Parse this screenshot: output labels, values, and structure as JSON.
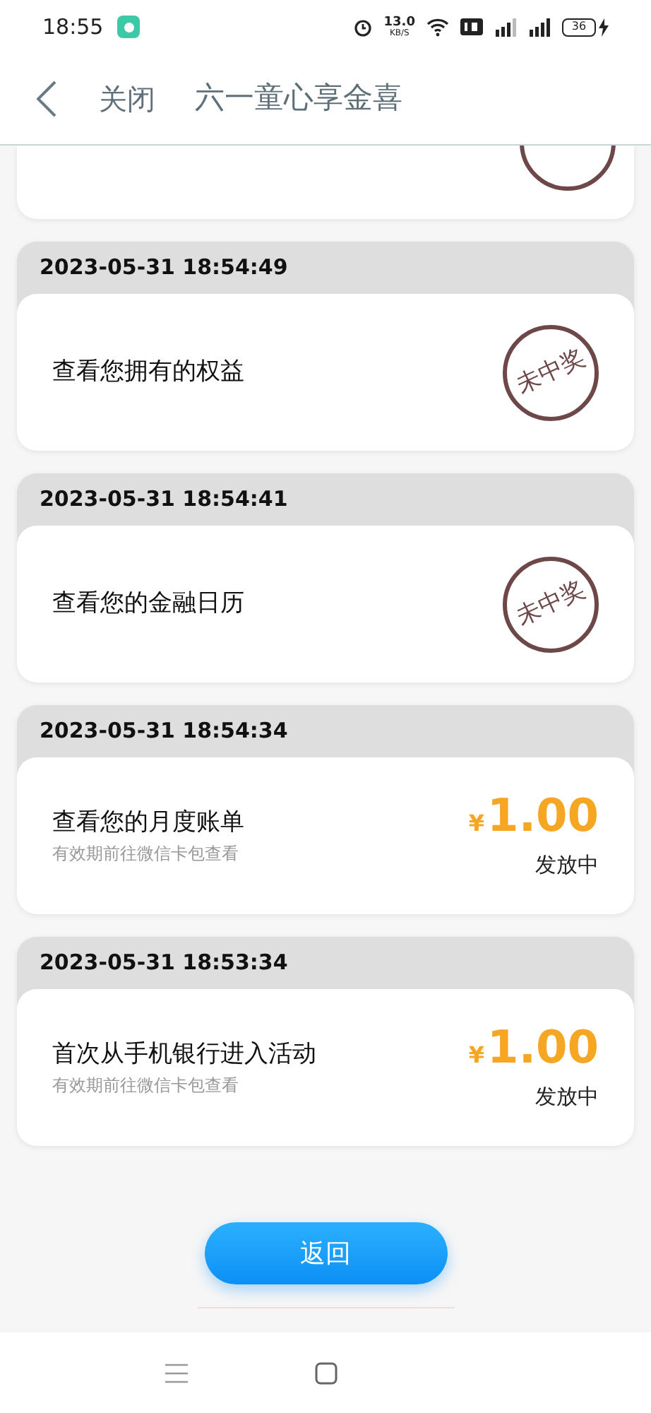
{
  "status_bar": {
    "time": "18:55",
    "speed": "13.0",
    "speed_unit": "KB/S",
    "battery": "36"
  },
  "header": {
    "close": "关闭",
    "title": "六一童心享金喜"
  },
  "records": [
    {
      "kind": "stamp",
      "time": "2023-05-31 18:54:49",
      "title": "查看您拥有的权益",
      "stamp": "未中奖"
    },
    {
      "kind": "stamp",
      "time": "2023-05-31 18:54:41",
      "title": "查看您的金融日历",
      "stamp": "未中奖"
    },
    {
      "kind": "reward",
      "time": "2023-05-31 18:54:34",
      "title": "查看您的月度账单",
      "note": "有效期前往微信卡包查看",
      "currency": "¥",
      "amount": "1.00",
      "status": "发放中"
    },
    {
      "kind": "reward",
      "time": "2023-05-31 18:53:34",
      "title": "首次从手机银行进入活动",
      "note": "有效期前往微信卡包查看",
      "currency": "¥",
      "amount": "1.00",
      "status": "发放中"
    }
  ],
  "back_button": "返回"
}
